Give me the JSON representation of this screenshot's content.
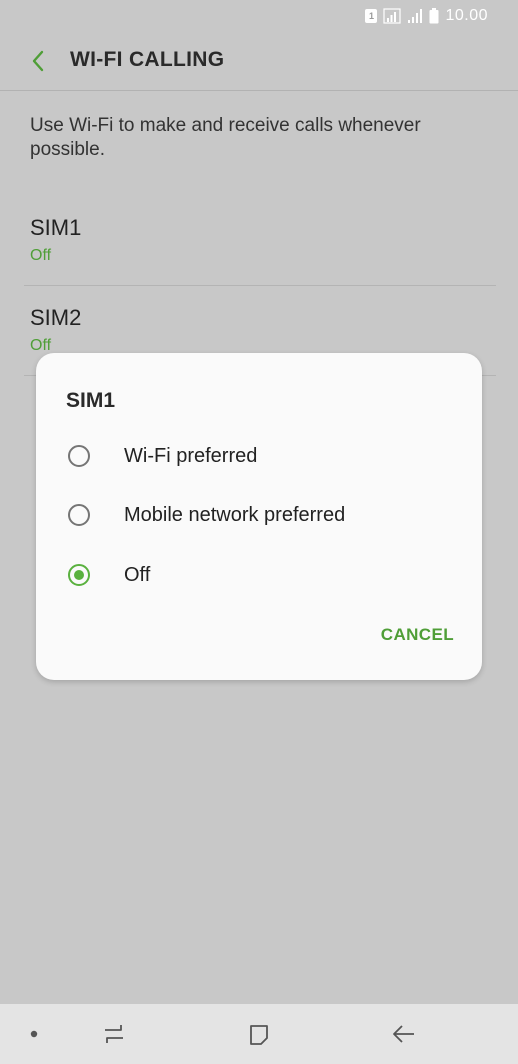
{
  "status_bar": {
    "sim_badge": "1",
    "time": "10.00",
    "icons": [
      "sim-1-icon",
      "signal-icon",
      "signal-icon",
      "battery-icon"
    ]
  },
  "header": {
    "title": "WI-FI CALLING",
    "back_icon": "chevron-left-icon"
  },
  "main": {
    "description": "Use Wi-Fi to make and receive calls whenever possible.",
    "sims": [
      {
        "title": "SIM1",
        "status": "Off"
      },
      {
        "title": "SIM2",
        "status": "Off"
      }
    ]
  },
  "dialog": {
    "title": "SIM1",
    "options": [
      {
        "label": "Wi-Fi preferred",
        "selected": false
      },
      {
        "label": "Mobile network preferred",
        "selected": false
      },
      {
        "label": "Off",
        "selected": true
      }
    ],
    "cancel_label": "CANCEL"
  },
  "nav_bar": {
    "icons": [
      "dot-icon",
      "recent-apps-icon",
      "home-icon",
      "back-icon"
    ]
  },
  "colors": {
    "accent": "#5ab13f",
    "accent_text": "#4f9e37",
    "background": "#c8c8c8",
    "dialog_background": "#fafafa"
  }
}
